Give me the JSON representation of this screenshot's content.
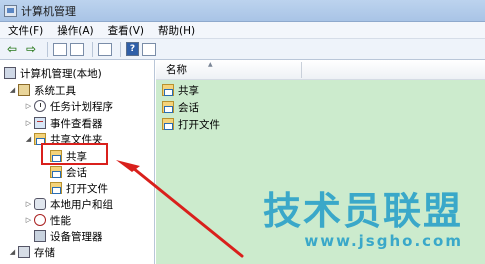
{
  "window": {
    "title": "计算机管理"
  },
  "menu": [
    "文件(F)",
    "操作(A)",
    "查看(V)",
    "帮助(H)"
  ],
  "toolbar": {
    "help_label": "?"
  },
  "tree": {
    "root": "计算机管理(本地)",
    "system_tools": "系统工具",
    "task_scheduler": "任务计划程序",
    "event_viewer": "事件查看器",
    "shared_folders": "共享文件夹",
    "shares": "共享",
    "sessions": "会话",
    "open_files": "打开文件",
    "local_users": "本地用户和组",
    "performance": "性能",
    "device_manager": "设备管理器",
    "storage": "存储"
  },
  "list": {
    "column_name": "名称",
    "items": [
      "共享",
      "会话",
      "打开文件"
    ]
  },
  "watermark": {
    "title": "技术员联盟",
    "url": "www.jsgho.com"
  },
  "colors": {
    "list_background": "#ccebcd",
    "highlight": "#d9201c",
    "watermark": "#3aa8c9"
  }
}
